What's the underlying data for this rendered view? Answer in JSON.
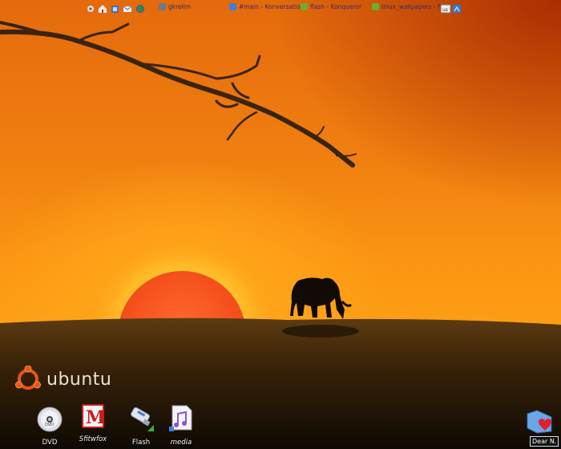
{
  "panel": {
    "quick_icons": [
      "gear-icon",
      "home-icon",
      "file-manager-icon",
      "mail-icon",
      "browser-globe-icon"
    ],
    "tasks": [
      {
        "label": "gkrellm",
        "icon": "gkrellm-icon",
        "color": "#6a7a8a"
      },
      {
        "label": "#main - Konversation",
        "icon": "konversation-icon",
        "color": "#3d7ee0"
      },
      {
        "label": "flash - Konqueror",
        "icon": "konqueror-icon",
        "color": "#6cae2e"
      },
      {
        "label": "linux_wallpapers - F",
        "icon": "folder-icon",
        "color": "#6cae2e"
      }
    ],
    "tray_icons": [
      "keyboard-icon",
      "system-tray-icon"
    ]
  },
  "logo": {
    "text": "ubuntu",
    "color": "#e95420"
  },
  "desktop_icons": [
    {
      "label": "DVD",
      "icon": "dvd-disc-icon"
    },
    {
      "label": "Sfitwfox",
      "icon": "mail-red-m-icon"
    },
    {
      "label": "Flash",
      "icon": "usb-flash-drive-icon"
    },
    {
      "label": "media",
      "icon": "media-file-icon"
    }
  ],
  "note": {
    "label": "Dear N.",
    "icon": "heart-folder-icon"
  }
}
